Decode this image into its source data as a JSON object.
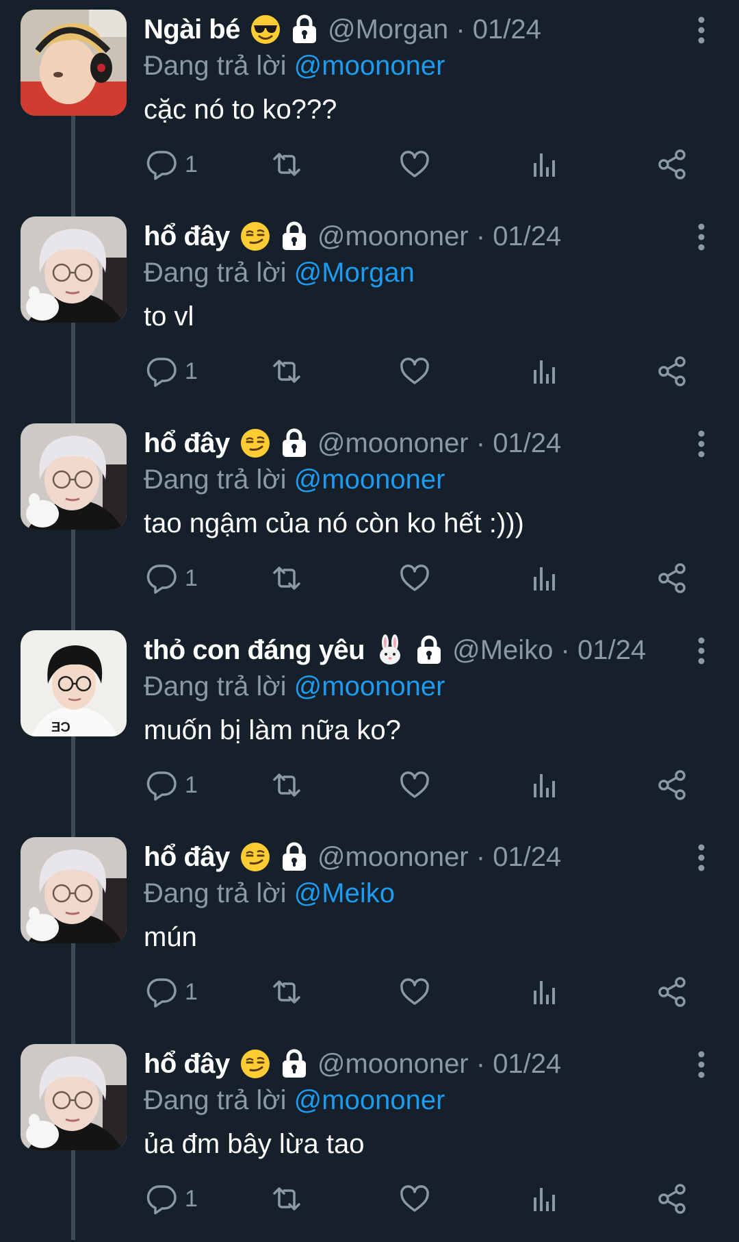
{
  "thread": [
    {
      "display_name": "Ngài bé",
      "status_emoji": "smiling-face-with-sunglasses",
      "handle": "@Morgan",
      "date": "01/24",
      "reply_prefix": "Đang trả lời",
      "reply_to": "@moononer",
      "text": "cặc nó to ko???",
      "reply_count": "1",
      "avatar": "person-with-headset"
    },
    {
      "display_name": "hổ đây",
      "status_emoji": "smirking-face",
      "handle": "@moononer",
      "date": "01/24",
      "reply_prefix": "Đang trả lời",
      "reply_to": "@Morgan",
      "text": "to vl",
      "reply_count": "1",
      "avatar": "person-light-hair-glasses"
    },
    {
      "display_name": "hổ đây",
      "status_emoji": "smirking-face",
      "handle": "@moononer",
      "date": "01/24",
      "reply_prefix": "Đang trả lời",
      "reply_to": "@moononer",
      "text": "tao ngậm của nó còn ko hết :)))",
      "reply_count": "1",
      "avatar": "person-light-hair-glasses"
    },
    {
      "display_name": "thỏ con đáng yêu",
      "status_emoji": "rabbit-face",
      "handle": "@Meiko",
      "date": "01/24",
      "reply_prefix": "Đang trả lời",
      "reply_to": "@moononer",
      "text": "muốn bị làm nữa ko?",
      "reply_count": "1",
      "avatar": "person-dark-hair-glasses"
    },
    {
      "display_name": "hổ đây",
      "status_emoji": "smirking-face",
      "handle": "@moononer",
      "date": "01/24",
      "reply_prefix": "Đang trả lời",
      "reply_to": "@Meiko",
      "text": "mún",
      "reply_count": "1",
      "avatar": "person-light-hair-glasses"
    },
    {
      "display_name": "hổ đây",
      "status_emoji": "smirking-face",
      "handle": "@moononer",
      "date": "01/24",
      "reply_prefix": "Đang trả lời",
      "reply_to": "@moononer",
      "text": "ủa đm bây lừa tao",
      "reply_count": "1",
      "avatar": "person-light-hair-glasses"
    }
  ],
  "icons": {
    "protected": "lock-icon",
    "more": "more-vertical-icon",
    "reply": "reply-icon",
    "retweet": "retweet-icon",
    "like": "heart-icon",
    "views": "views-icon",
    "share": "share-icon"
  },
  "colors": {
    "background": "#15202b",
    "text_primary": "#ffffff",
    "text_secondary": "#8b98a5",
    "link": "#1d9bf0",
    "thread_line": "#3d4a57"
  }
}
